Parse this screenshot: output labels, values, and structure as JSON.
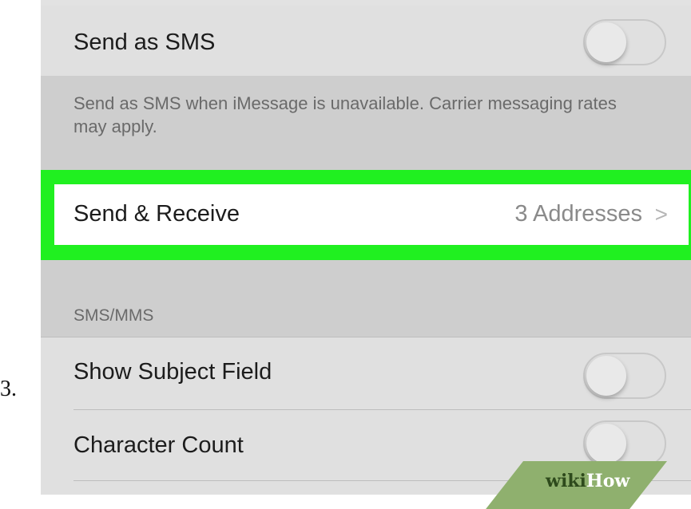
{
  "step": {
    "number": "3."
  },
  "rows": {
    "send_as_sms": {
      "label": "Send as SMS",
      "toggle_on": false
    },
    "sms_footer": "Send as SMS when iMessage is unavailable. Carrier messaging rates may apply.",
    "send_receive": {
      "label": "Send & Receive",
      "value": "3 Addresses",
      "chevron": ">"
    },
    "section_header": "SMS/MMS",
    "show_subject_field": {
      "label": "Show Subject Field",
      "toggle_on": false
    },
    "character_count": {
      "label": "Character Count",
      "toggle_on": false
    }
  },
  "watermark": {
    "wiki": "wiki",
    "how": "How"
  },
  "colors": {
    "highlight": "#20f020",
    "cell_background": "#e0e0e0",
    "group_background": "#cecece",
    "watermark": "#8fb06e"
  }
}
